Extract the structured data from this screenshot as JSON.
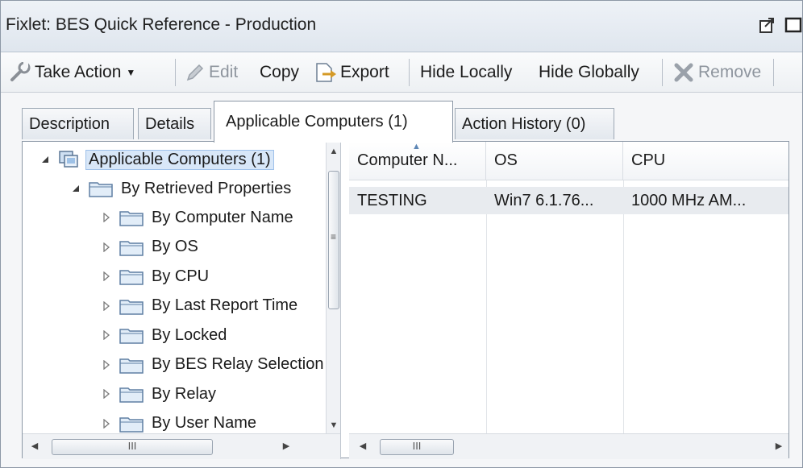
{
  "window": {
    "title": "Fixlet: BES Quick Reference - Production"
  },
  "toolbar": {
    "take_action": "Take Action",
    "edit": "Edit",
    "copy": "Copy",
    "export": "Export",
    "hide_locally": "Hide Locally",
    "hide_globally": "Hide Globally",
    "remove": "Remove"
  },
  "tabs": {
    "description": "Description",
    "details": "Details",
    "applicable": "Applicable Computers (1)",
    "history": "Action History (0)"
  },
  "tree": {
    "root": "Applicable Computers (1)",
    "group": "By Retrieved Properties",
    "items": [
      "By Computer Name",
      "By OS",
      "By CPU",
      "By Last Report Time",
      "By Locked",
      "By BES Relay Selection",
      "By Relay",
      "By User Name"
    ]
  },
  "table": {
    "columns": [
      "Computer N...",
      "OS",
      "CPU"
    ],
    "rows": [
      [
        "TESTING",
        "Win7 6.1.76...",
        "1000 MHz AM..."
      ]
    ]
  },
  "scroll": {
    "hthumb_label": "III"
  },
  "colors": {
    "selection": "#d8e7f8",
    "border": "#8c98a6",
    "accent": "#5d86b5"
  }
}
